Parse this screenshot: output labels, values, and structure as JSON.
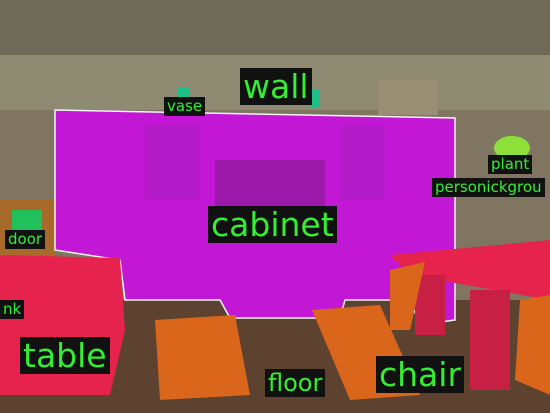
{
  "image": {
    "description_free": true,
    "labels": {
      "wall": "wall",
      "vase": "vase",
      "plant": "plant",
      "person": "personickgrou",
      "cabinet": "cabinet",
      "door": "door",
      "sink": "nk",
      "table": "table",
      "floor": "floor",
      "chair": "chair"
    }
  },
  "colors": {
    "wall": "#8a7d64",
    "cabinet": "#c218d6",
    "table": "#e5234d",
    "chair": "#d9661a",
    "floor": "#6e4a33",
    "plant": "#8de03a",
    "vase": "#1fbf8a",
    "label_text": "#33ee33",
    "label_bg": "#111111"
  }
}
